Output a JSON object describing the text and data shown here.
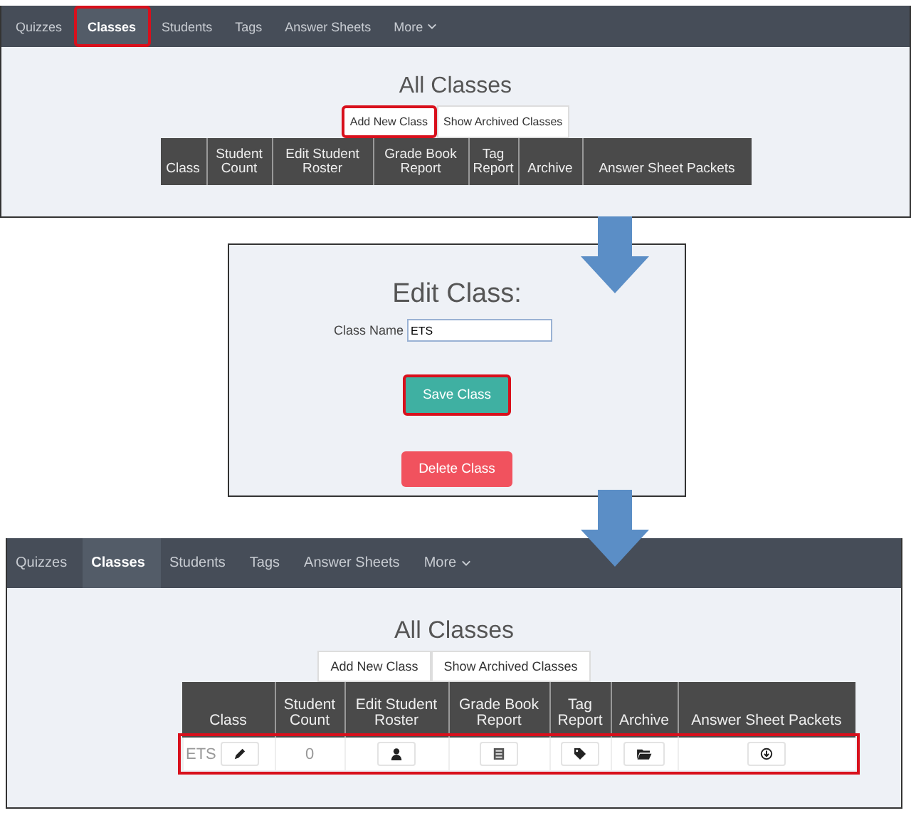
{
  "panels": [
    {
      "kind": "list",
      "nav": [
        {
          "label": "Quizzes",
          "selected": false,
          "highlighted": false
        },
        {
          "label": "Classes",
          "selected": true,
          "highlighted": true
        },
        {
          "label": "Students",
          "selected": false,
          "highlighted": false
        },
        {
          "label": "Tags",
          "selected": false,
          "highlighted": false
        },
        {
          "label": "Answer Sheets",
          "selected": false,
          "highlighted": false
        },
        {
          "label": "More",
          "selected": false,
          "highlighted": false,
          "dropdown": true
        }
      ],
      "title": "All Classes",
      "actions": [
        {
          "label": "Add New Class",
          "highlighted": true
        },
        {
          "label": "Show Archived Classes",
          "highlighted": false
        }
      ],
      "columns": [
        "Class",
        "Student Count",
        "Edit Student Roster",
        "Grade Book Report",
        "Tag Report",
        "Archive",
        "Answer Sheet Packets"
      ]
    },
    {
      "kind": "edit",
      "title": "Edit Class:",
      "field": {
        "label": "Class Name",
        "value": "ETS"
      },
      "buttons": [
        {
          "label": "Save Class",
          "kind": "save",
          "highlighted": true
        },
        {
          "label": "Delete Class",
          "kind": "delete",
          "highlighted": false
        }
      ]
    },
    {
      "kind": "list",
      "nav": [
        {
          "label": "Quizzes",
          "selected": false,
          "highlighted": false
        },
        {
          "label": "Classes",
          "selected": true,
          "highlighted": false
        },
        {
          "label": "Students",
          "selected": false,
          "highlighted": false
        },
        {
          "label": "Tags",
          "selected": false,
          "highlighted": false
        },
        {
          "label": "Answer Sheets",
          "selected": false,
          "highlighted": false
        },
        {
          "label": "More",
          "selected": false,
          "highlighted": false,
          "dropdown": true
        }
      ],
      "title": "All Classes",
      "actions": [
        {
          "label": "Add New Class",
          "highlighted": false
        },
        {
          "label": "Show Archived Classes",
          "highlighted": false
        }
      ],
      "columns": [
        "Class",
        "Student Count",
        "Edit Student Roster",
        "Grade Book Report",
        "Tag Report",
        "Archive",
        "Answer Sheet Packets"
      ],
      "rows": [
        {
          "name": "ETS",
          "count": "0",
          "highlighted": true
        }
      ]
    }
  ]
}
